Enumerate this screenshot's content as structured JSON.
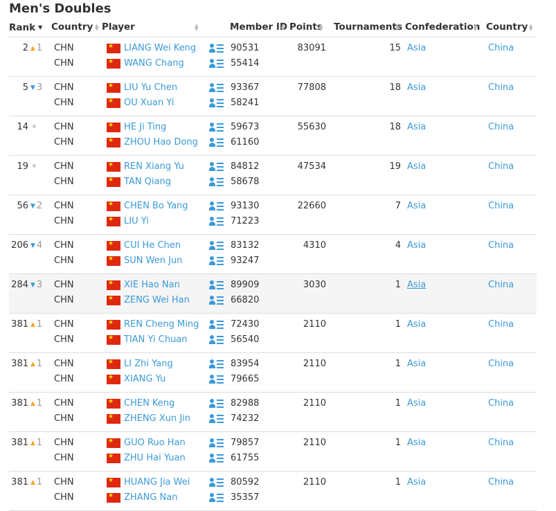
{
  "title": "Men's Doubles",
  "headers": {
    "rank": "Rank",
    "country": "Country",
    "player": "Player",
    "member_id": "Member ID",
    "points": "Points",
    "tournaments": "Tournaments",
    "confederation": "Confederation",
    "country2": "Country"
  },
  "colors": {
    "link": "#3a9ad9",
    "up": "#f5a623",
    "down": "#3a9ad9",
    "flag": "#de2910"
  },
  "rows": [
    {
      "rank": "2",
      "trend": "up",
      "change": "1",
      "points": "83091",
      "tournaments": "15",
      "confederation": "Asia",
      "country": "China",
      "players": [
        {
          "country": "CHN",
          "name": "LIANG Wei Keng",
          "id": "90531"
        },
        {
          "country": "CHN",
          "name": "WANG Chang",
          "id": "55414"
        }
      ]
    },
    {
      "rank": "5",
      "trend": "down",
      "change": "3",
      "points": "77808",
      "tournaments": "18",
      "confederation": "Asia",
      "country": "China",
      "players": [
        {
          "country": "CHN",
          "name": "LIU Yu Chen",
          "id": "93367"
        },
        {
          "country": "CHN",
          "name": "OU Xuan Yi",
          "id": "58241"
        }
      ]
    },
    {
      "rank": "14",
      "trend": "same",
      "change": "",
      "points": "55630",
      "tournaments": "18",
      "confederation": "Asia",
      "country": "China",
      "players": [
        {
          "country": "CHN",
          "name": "HE Ji Ting",
          "id": "59673"
        },
        {
          "country": "CHN",
          "name": "ZHOU Hao Dong",
          "id": "61160"
        }
      ]
    },
    {
      "rank": "19",
      "trend": "same",
      "change": "",
      "points": "47534",
      "tournaments": "19",
      "confederation": "Asia",
      "country": "China",
      "players": [
        {
          "country": "CHN",
          "name": "REN Xiang Yu",
          "id": "84812"
        },
        {
          "country": "CHN",
          "name": "TAN Qiang",
          "id": "58678"
        }
      ]
    },
    {
      "rank": "56",
      "trend": "down",
      "change": "2",
      "points": "22660",
      "tournaments": "7",
      "confederation": "Asia",
      "country": "China",
      "players": [
        {
          "country": "CHN",
          "name": "CHEN Bo Yang",
          "id": "93130"
        },
        {
          "country": "CHN",
          "name": "LIU Yi",
          "id": "71223"
        }
      ]
    },
    {
      "rank": "206",
      "trend": "down",
      "change": "4",
      "points": "4310",
      "tournaments": "4",
      "confederation": "Asia",
      "country": "China",
      "players": [
        {
          "country": "CHN",
          "name": "CUI He Chen",
          "id": "83132"
        },
        {
          "country": "CHN",
          "name": "SUN Wen Jun",
          "id": "93247"
        }
      ]
    },
    {
      "rank": "284",
      "trend": "down",
      "change": "3",
      "points": "3030",
      "tournaments": "1",
      "confederation": "Asia",
      "country": "China",
      "players": [
        {
          "country": "CHN",
          "name": "XIE Hao Nan",
          "id": "89909"
        },
        {
          "country": "CHN",
          "name": "ZENG Wei Han",
          "id": "66820"
        }
      ]
    },
    {
      "rank": "381",
      "trend": "up",
      "change": "1",
      "points": "2110",
      "tournaments": "1",
      "confederation": "Asia",
      "country": "China",
      "players": [
        {
          "country": "CHN",
          "name": "REN Cheng Ming",
          "id": "72430"
        },
        {
          "country": "CHN",
          "name": "TIAN Yi Chuan",
          "id": "56540"
        }
      ]
    },
    {
      "rank": "381",
      "trend": "up",
      "change": "1",
      "points": "2110",
      "tournaments": "1",
      "confederation": "Asia",
      "country": "China",
      "players": [
        {
          "country": "CHN",
          "name": "LI Zhi Yang",
          "id": "83954"
        },
        {
          "country": "CHN",
          "name": "XIANG Yu",
          "id": "79665"
        }
      ]
    },
    {
      "rank": "381",
      "trend": "up",
      "change": "1",
      "points": "2110",
      "tournaments": "1",
      "confederation": "Asia",
      "country": "China",
      "players": [
        {
          "country": "CHN",
          "name": "CHEN Keng",
          "id": "82988"
        },
        {
          "country": "CHN",
          "name": "ZHENG Xun Jin",
          "id": "74232"
        }
      ]
    },
    {
      "rank": "381",
      "trend": "up",
      "change": "1",
      "points": "2110",
      "tournaments": "1",
      "confederation": "Asia",
      "country": "China",
      "players": [
        {
          "country": "CHN",
          "name": "GUO Ruo Han",
          "id": "79857"
        },
        {
          "country": "CHN",
          "name": "ZHU Hai Yuan",
          "id": "61755"
        }
      ]
    },
    {
      "rank": "381",
      "trend": "up",
      "change": "1",
      "points": "2110",
      "tournaments": "1",
      "confederation": "Asia",
      "country": "China",
      "players": [
        {
          "country": "CHN",
          "name": "HUANG Jia Wei",
          "id": "80592"
        },
        {
          "country": "CHN",
          "name": "ZHANG Nan",
          "id": "35357"
        }
      ]
    }
  ]
}
